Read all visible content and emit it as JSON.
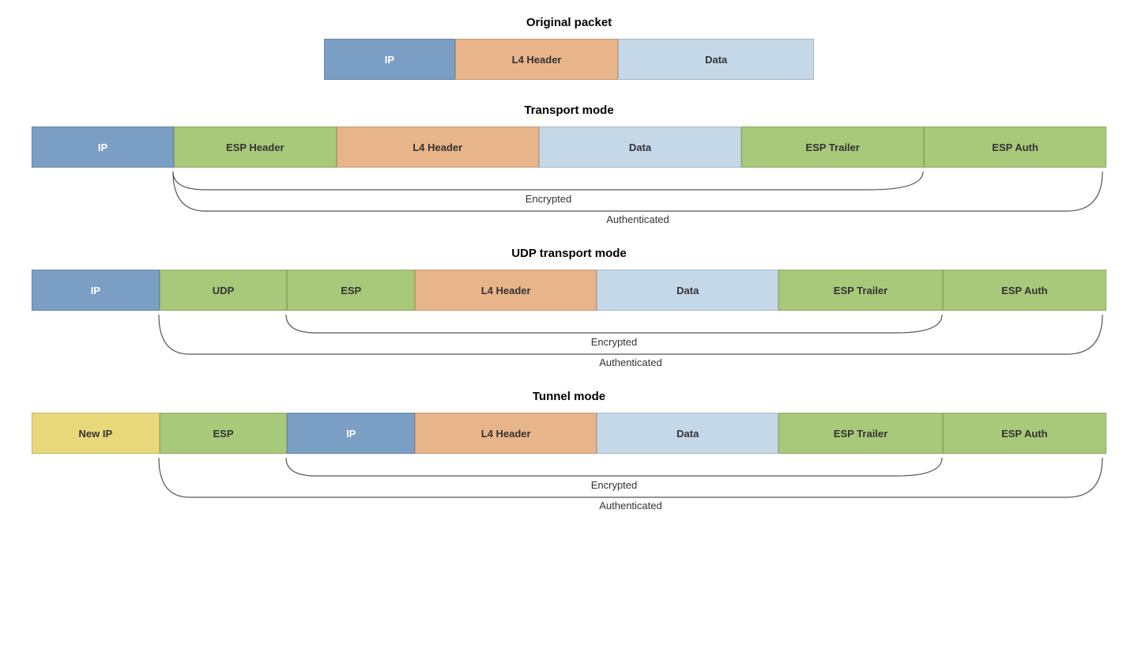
{
  "original": {
    "title": "Original packet",
    "cells": [
      {
        "label": "IP",
        "color": "blue",
        "flex": 2
      },
      {
        "label": "L4 Header",
        "color": "orange",
        "flex": 2.5
      },
      {
        "label": "Data",
        "color": "lightblue",
        "flex": 3
      }
    ]
  },
  "transport": {
    "title": "Transport mode",
    "cells": [
      {
        "label": "IP",
        "color": "blue",
        "flex": 1.4
      },
      {
        "label": "ESP Header",
        "color": "green",
        "flex": 1.6
      },
      {
        "label": "L4 Header",
        "color": "orange",
        "flex": 2
      },
      {
        "label": "Data",
        "color": "lightblue",
        "flex": 2
      },
      {
        "label": "ESP Trailer",
        "color": "green",
        "flex": 1.8
      },
      {
        "label": "ESP Auth",
        "color": "green",
        "flex": 1.8
      }
    ],
    "encrypted_start_flex": 1.4,
    "encrypted_end_flex": 1.8,
    "encrypted_label": "Encrypted",
    "authenticated_label": "Authenticated"
  },
  "udp_transport": {
    "title": "UDP transport mode",
    "cells": [
      {
        "label": "IP",
        "color": "blue",
        "flex": 1.4
      },
      {
        "label": "UDP",
        "color": "green",
        "flex": 1.4
      },
      {
        "label": "ESP",
        "color": "green",
        "flex": 1.4
      },
      {
        "label": "L4 Header",
        "color": "orange",
        "flex": 2
      },
      {
        "label": "Data",
        "color": "lightblue",
        "flex": 2
      },
      {
        "label": "ESP Trailer",
        "color": "green",
        "flex": 1.8
      },
      {
        "label": "ESP Auth",
        "color": "green",
        "flex": 1.8
      }
    ],
    "encrypted_label": "Encrypted",
    "authenticated_label": "Authenticated"
  },
  "tunnel": {
    "title": "Tunnel mode",
    "cells": [
      {
        "label": "New IP",
        "color": "yellow",
        "flex": 1.4
      },
      {
        "label": "ESP",
        "color": "green",
        "flex": 1.4
      },
      {
        "label": "IP",
        "color": "blue",
        "flex": 1.4
      },
      {
        "label": "L4 Header",
        "color": "orange",
        "flex": 2
      },
      {
        "label": "Data",
        "color": "lightblue",
        "flex": 2
      },
      {
        "label": "ESP Trailer",
        "color": "green",
        "flex": 1.8
      },
      {
        "label": "ESP Auth",
        "color": "green",
        "flex": 1.8
      }
    ],
    "encrypted_label": "Encrypted",
    "authenticated_label": "Authenticated"
  }
}
